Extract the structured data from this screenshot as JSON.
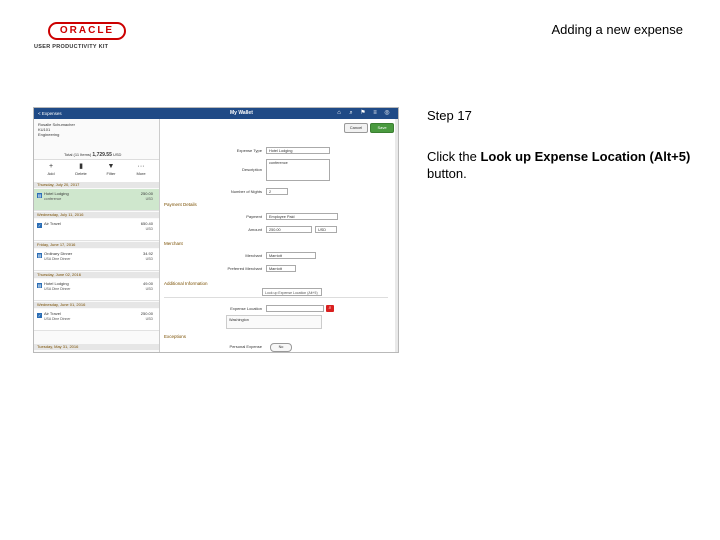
{
  "logo": {
    "word": "ORACLE",
    "sub": "USER PRODUCTIVITY KIT"
  },
  "topic_title": "Adding a new expense",
  "step_label": "Step 17",
  "instruction": {
    "prefix": "Click the ",
    "target": "Look up Expense Location (Alt+5)",
    "suffix": " button."
  },
  "app": {
    "title_left": "< Expenses",
    "title_center": "My Wallet",
    "profile": {
      "name": "Rosalie Schumacher",
      "id": "KU101",
      "role": "Engineering"
    },
    "total": {
      "label": "Total (11 Items)",
      "amount": "1,729.55",
      "currency": "USD"
    },
    "actions": [
      {
        "glyph": "+",
        "label": "Add"
      },
      {
        "glyph": "▮",
        "label": "Delete"
      },
      {
        "glyph": "▼",
        "label": "Filter"
      },
      {
        "glyph": "···",
        "label": "More"
      }
    ],
    "dates": [
      "Thursday, July 20, 2017",
      "Wednesday, July 11, 2016",
      "Friday, June 17, 2016",
      "Thursday, June 02, 2016",
      "Wednesday, June 01, 2016",
      "Tuesday, May 31, 2016"
    ],
    "entries": [
      {
        "name": "Hotel Lodging",
        "sub": "conference",
        "amount": "250.00",
        "status": "USD"
      },
      {
        "name": "Air Travel",
        "sub": "",
        "amount": "650.40",
        "status": "USD"
      },
      {
        "name": "Ordinary Dinner",
        "sub": "USA Dine Dinner",
        "amount": "34.92",
        "status": "USD"
      },
      {
        "name": "Hotel Lodging",
        "sub": "USA Dine Dinner",
        "amount": "49.00",
        "status": "USD"
      },
      {
        "name": "Air Travel",
        "sub": "USA Dine Dinner",
        "amount": "250.00",
        "status": "USD"
      }
    ],
    "buttons": {
      "cancel": "Cancel",
      "save": "Save"
    },
    "form": {
      "expense_type_label": "Expense Type",
      "expense_type_value": "Hotel Lodging",
      "description_label": "Description",
      "description_value": "conference",
      "nights_label": "Number of Nights",
      "nights_value": "2",
      "payment_section": "Payment Details",
      "payment_label": "Payment",
      "payment_value": "Employee Paid",
      "amount_label": "Amount",
      "amount_value": "250.00",
      "currency_value": "USD",
      "merchant_section": "Merchant",
      "merchant_label": "Merchant",
      "merchant_value": "Marriott",
      "preferred_label": "Preferred Merchant",
      "preferred_value": "Marriott",
      "additional_section": "Additional Information",
      "tooltip": "Look up Expense Location (Alt+5)",
      "location_label": "Expense Location",
      "location_result": "Washington",
      "exceptions_section": "Exceptions",
      "personal_label": "Personal Expense",
      "personal_value": "No"
    }
  }
}
